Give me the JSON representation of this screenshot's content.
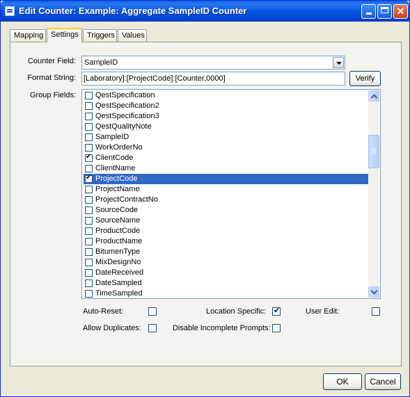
{
  "window": {
    "title": "Edit Counter: Example: Aggregate SampleID Counter"
  },
  "tabs": [
    {
      "label": "Mapping",
      "active": false
    },
    {
      "label": "Settings",
      "active": true
    },
    {
      "label": "Triggers",
      "active": false
    },
    {
      "label": "Values",
      "active": false
    }
  ],
  "settings": {
    "counter_field_label": "Counter Field:",
    "counter_field_value": "SampleID",
    "format_string_label": "Format String:",
    "format_string_value": "[Laboratory]:[ProjectCode]:[Counter,0000]",
    "verify_label": "Verify",
    "group_fields_label": "Group Fields:",
    "group_fields": [
      {
        "label": "QestSpecification",
        "checked": false,
        "selected": false
      },
      {
        "label": "QestSpecification2",
        "checked": false,
        "selected": false
      },
      {
        "label": "QestSpecification3",
        "checked": false,
        "selected": false
      },
      {
        "label": "QestQualityNote",
        "checked": false,
        "selected": false
      },
      {
        "label": "SampleID",
        "checked": false,
        "selected": false
      },
      {
        "label": "WorkOrderNo",
        "checked": false,
        "selected": false
      },
      {
        "label": "ClientCode",
        "checked": true,
        "selected": false
      },
      {
        "label": "ClientName",
        "checked": false,
        "selected": false
      },
      {
        "label": "ProjectCode",
        "checked": true,
        "selected": true
      },
      {
        "label": "ProjectName",
        "checked": false,
        "selected": false
      },
      {
        "label": "ProjectContractNo",
        "checked": false,
        "selected": false
      },
      {
        "label": "SourceCode",
        "checked": false,
        "selected": false
      },
      {
        "label": "SourceName",
        "checked": false,
        "selected": false
      },
      {
        "label": "ProductCode",
        "checked": false,
        "selected": false
      },
      {
        "label": "ProductName",
        "checked": false,
        "selected": false
      },
      {
        "label": "BitumenType",
        "checked": false,
        "selected": false
      },
      {
        "label": "MixDesignNo",
        "checked": false,
        "selected": false
      },
      {
        "label": "DateReceived",
        "checked": false,
        "selected": false
      },
      {
        "label": "DateSampled",
        "checked": false,
        "selected": false
      },
      {
        "label": "TimeSampled",
        "checked": false,
        "selected": false
      }
    ],
    "auto_reset_label": "Auto-Reset:",
    "auto_reset": false,
    "location_specific_label": "Location Specific:",
    "location_specific": true,
    "user_edit_label": "User Edit:",
    "user_edit": false,
    "allow_duplicates_label": "Allow Duplicates:",
    "allow_duplicates": false,
    "disable_incomplete_prompts_label": "Disable Incomplete Prompts:",
    "disable_incomplete_prompts": false
  },
  "footer": {
    "ok_label": "OK",
    "cancel_label": "Cancel"
  }
}
